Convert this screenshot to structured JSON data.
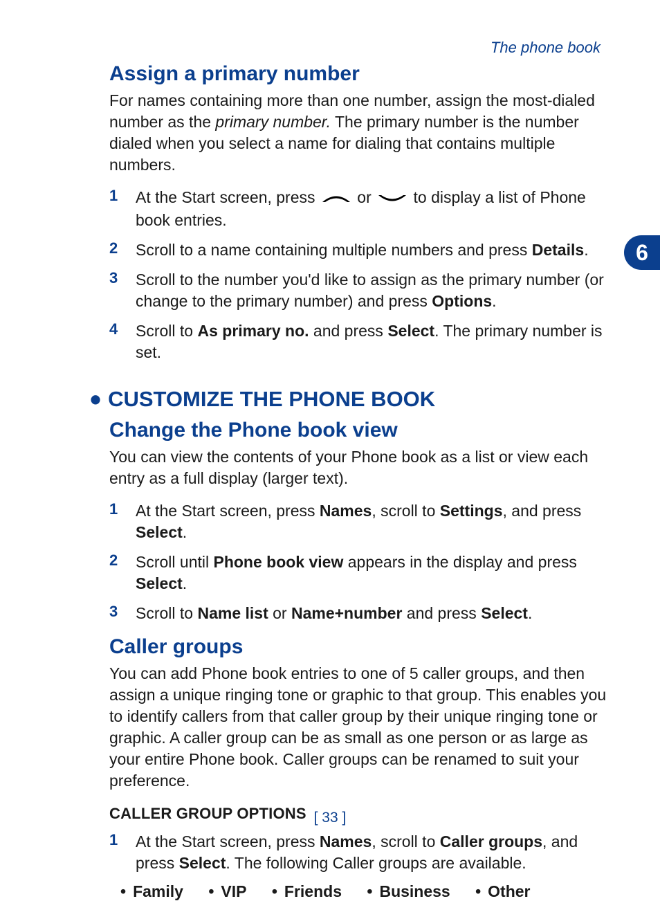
{
  "running_header": "The phone book",
  "chapter_tab": "6",
  "page_number": "[ 33 ]",
  "sections": {
    "assign_primary": {
      "title": "Assign a primary number",
      "intro_pre": "For names containing more than one number, assign the most-dialed number as the ",
      "intro_term": "primary number.",
      "intro_post": " The primary number is the number dialed when you select a name for dialing that contains multiple numbers.",
      "steps": [
        {
          "n": "1",
          "pre": "At the Start screen, press ",
          "mid": " or ",
          "post": " to display a list of Phone book entries."
        },
        {
          "n": "2",
          "pre": "Scroll to a name containing multiple numbers and press ",
          "b1": "Details",
          "post": "."
        },
        {
          "n": "3",
          "pre": "Scroll to the number you'd like to assign as the primary number (or change to the primary number) and press ",
          "b1": "Options",
          "post": "."
        },
        {
          "n": "4",
          "pre": "Scroll to ",
          "b1": "As primary no.",
          "mid": " and press ",
          "b2": "Select",
          "post": ". The primary number is set."
        }
      ]
    },
    "customize": {
      "title": "CUSTOMIZE THE PHONE BOOK",
      "change_view": {
        "title": "Change the Phone book view",
        "intro": "You can view the contents of your Phone book as a list or view each entry as a full display (larger text).",
        "steps": [
          {
            "n": "1",
            "pre": "At the Start screen, press ",
            "b1": "Names",
            "mid1": ", scroll to ",
            "b2": "Settings",
            "mid2": ", and press ",
            "b3": "Select",
            "post": "."
          },
          {
            "n": "2",
            "pre": "Scroll until ",
            "b1": "Phone book view",
            "mid1": " appears in the display and press ",
            "b2": "Select",
            "post": "."
          },
          {
            "n": "3",
            "pre": "Scroll to ",
            "b1": "Name list",
            "mid1": " or ",
            "b2": "Name+number",
            "mid2": " and press ",
            "b3": "Select",
            "post": "."
          }
        ]
      },
      "caller_groups": {
        "title": "Caller groups",
        "intro": "You can add Phone book entries to one of 5 caller groups, and then assign a unique ringing tone or graphic to that group. This enables you to identify callers from that caller group by their unique ringing tone or graphic. A caller group can be as small as one person or as large as your entire Phone book. Caller groups can be renamed to suit your preference.",
        "options_header": "CALLER GROUP OPTIONS",
        "steps": [
          {
            "n": "1",
            "pre": "At the Start screen, press ",
            "b1": "Names",
            "mid1": ", scroll to ",
            "b2": "Caller groups",
            "mid2": ", and press ",
            "b3": "Select",
            "post": ". The following Caller groups are available."
          }
        ],
        "groups": [
          "Family",
          "VIP",
          "Friends",
          "Business",
          "Other"
        ]
      }
    }
  }
}
